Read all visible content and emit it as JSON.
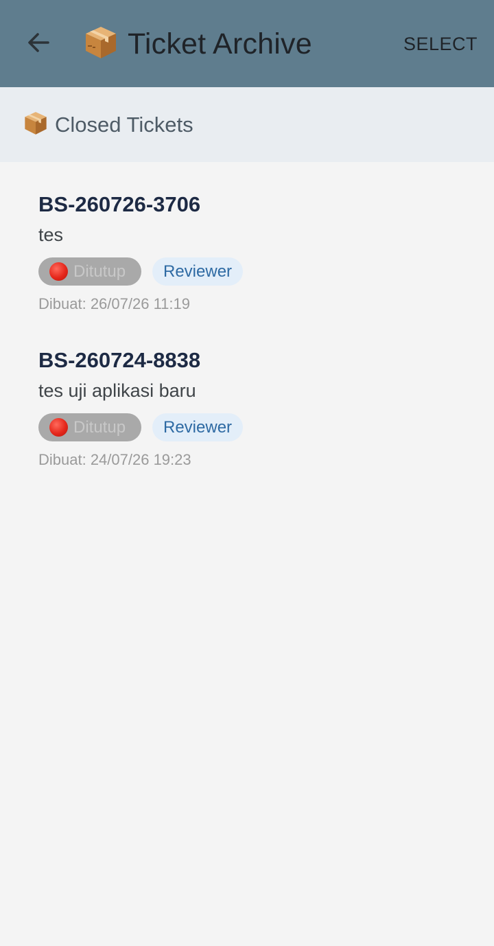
{
  "appbar": {
    "back_icon": "arrow-left-icon",
    "title_icon": "package-box-icon",
    "title": "Ticket Archive",
    "select_label": "SELECT"
  },
  "section": {
    "icon": "package-box-icon",
    "title": "Closed Tickets"
  },
  "tickets": [
    {
      "id": "BS-260726-3706",
      "description": "tes",
      "status_icon": "red-circle-icon",
      "status": "Ditutup",
      "role": "Reviewer",
      "created": "Dibuat: 26/07/26 11:19"
    },
    {
      "id": "BS-260724-8838",
      "description": "tes uji aplikasi baru",
      "status_icon": "red-circle-icon",
      "status": "Ditutup",
      "role": "Reviewer",
      "created": "Dibuat: 24/07/26 19:23"
    }
  ],
  "colors": {
    "appbar_bg": "#5f7d8e",
    "section_bg": "#e9edf1",
    "page_bg": "#f4f4f4",
    "status_badge_bg": "#a9a9a9",
    "role_badge_bg": "#e3eef9",
    "role_text": "#2e6aa3",
    "ticket_id_text": "#1d2a44"
  }
}
